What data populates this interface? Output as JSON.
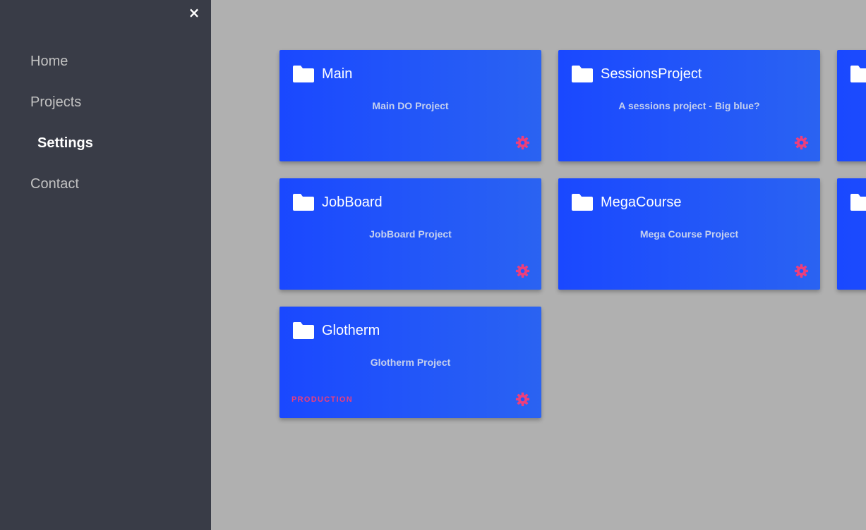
{
  "sidebar": {
    "close_label": "×",
    "items": [
      {
        "label": "Home",
        "active": false
      },
      {
        "label": "Projects",
        "active": false
      },
      {
        "label": "Settings",
        "active": true
      },
      {
        "label": "Contact",
        "active": false
      }
    ]
  },
  "projects": [
    {
      "title": "Main",
      "description": "Main DO Project",
      "badge": ""
    },
    {
      "title": "SessionsProject",
      "description": "A sessions project - Big blue?",
      "badge": ""
    },
    {
      "title": "",
      "description": "",
      "badge": ""
    },
    {
      "title": "JobBoard",
      "description": "JobBoard Project",
      "badge": ""
    },
    {
      "title": "MegaCourse",
      "description": "Mega Course Project",
      "badge": ""
    },
    {
      "title": "",
      "description": "",
      "badge": ""
    },
    {
      "title": "Glotherm",
      "description": "Glotherm Project",
      "badge": "PRODUCTION"
    }
  ],
  "icons": {
    "folder": "folder-icon",
    "settings": "gear-icon",
    "close": "close-icon"
  },
  "colors": {
    "sidebar_bg": "#393c47",
    "page_bg": "#b0b0b0",
    "card_bg": "#1a48ff",
    "accent": "#ec3f7c",
    "nav_text": "#c2c2c2",
    "nav_active": "#ffffff"
  }
}
